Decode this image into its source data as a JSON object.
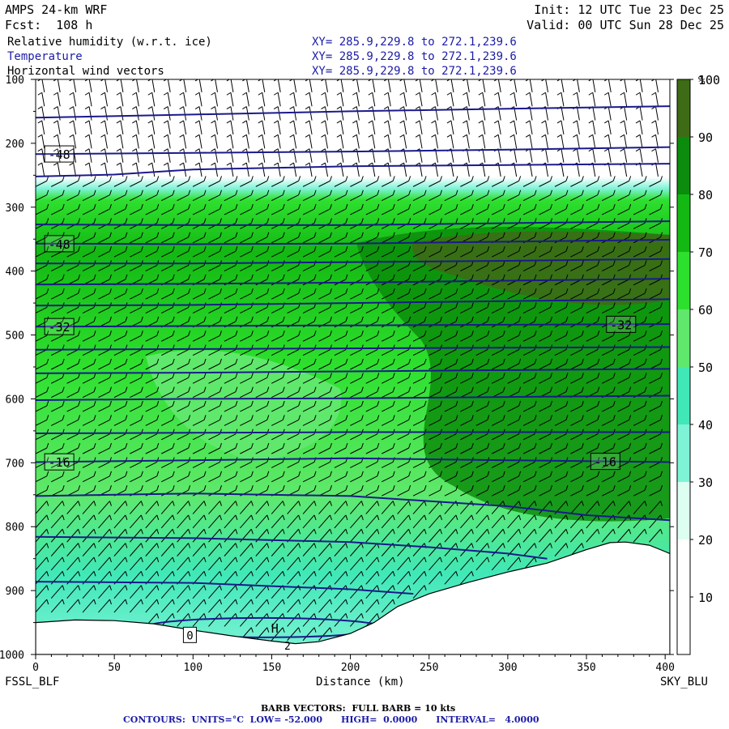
{
  "header": {
    "model": "AMPS 24-km WRF",
    "fcst": "Fcst:  108 h",
    "init": "Init: 12 UTC Tue 23 Dec 25",
    "valid": "Valid: 00 UTC Sun 28 Dec 25",
    "fields": [
      {
        "name": "Relative humidity (w.r.t. ice)",
        "xy": "XY= 285.9,229.8 to 272.1,239.6",
        "color": "#000000"
      },
      {
        "name": "Temperature",
        "xy": "XY= 285.9,229.8 to 272.1,239.6",
        "color": "#1c1ca8"
      },
      {
        "name": "Horizontal wind vectors",
        "xy": "XY= 285.9,229.8 to 272.1,239.6",
        "color": "#000000"
      }
    ]
  },
  "endpoints": {
    "left": "FSSL_BLF",
    "right": "SKY_BLU"
  },
  "footer": {
    "barb": "BARB VECTORS:  FULL BARB = 10 kts",
    "contours": "CONTOURS:  UNITS=°C  LOW= -52.000      HIGH=  0.0000      INTERVAL=   4.0000"
  },
  "chart_data": {
    "type": "heatmap",
    "title": "Relative humidity (w.r.t. ice)",
    "xlabel": "Distance (km)",
    "ylabel": "",
    "xlim": [
      0,
      400
    ],
    "ylim": [
      1000,
      100
    ],
    "x_ticks": [
      "0",
      "50",
      "100",
      "150",
      "200",
      "250",
      "300",
      "350",
      "400"
    ],
    "y_ticks": [
      "100",
      "200",
      "300",
      "400",
      "500",
      "600",
      "700",
      "800",
      "900",
      "1000"
    ],
    "colorbar": {
      "unit": "%",
      "ticks": [
        "10",
        "20",
        "30",
        "40",
        "50",
        "60",
        "70",
        "80",
        "90",
        "100"
      ],
      "colors": [
        "#ffffff",
        "#ffffff",
        "#dcfff2",
        "#7ef3d6",
        "#40e8b8",
        "#5fe86b",
        "#2ee02e",
        "#13b813",
        "#0c8c0c",
        "#3d6b16"
      ]
    },
    "terrain": [
      [
        0,
        950
      ],
      [
        25,
        946
      ],
      [
        50,
        947
      ],
      [
        75,
        952
      ],
      [
        100,
        962
      ],
      [
        125,
        971
      ],
      [
        150,
        979
      ],
      [
        165,
        983
      ],
      [
        180,
        980
      ],
      [
        200,
        967
      ],
      [
        215,
        950
      ],
      [
        230,
        925
      ],
      [
        250,
        905
      ],
      [
        275,
        887
      ],
      [
        300,
        871
      ],
      [
        325,
        857
      ],
      [
        350,
        836
      ],
      [
        365,
        825
      ],
      [
        375,
        824
      ],
      [
        390,
        829
      ],
      [
        400,
        839
      ],
      [
        403,
        842
      ]
    ],
    "temperature_contours": [
      {
        "label": "",
        "points": [
          [
            0,
            160
          ],
          [
            100,
            155
          ],
          [
            200,
            150
          ],
          [
            300,
            146
          ],
          [
            403,
            142
          ]
        ]
      },
      {
        "label": "-48",
        "points": [
          [
            0,
            217
          ],
          [
            100,
            215
          ],
          [
            200,
            213
          ],
          [
            300,
            210
          ],
          [
            403,
            206
          ]
        ]
      },
      {
        "label": "",
        "points": [
          [
            0,
            252
          ],
          [
            50,
            249
          ],
          [
            100,
            241
          ],
          [
            200,
            236
          ],
          [
            300,
            234
          ],
          [
            403,
            232
          ]
        ]
      },
      {
        "label": "",
        "points": [
          [
            0,
            327
          ],
          [
            100,
            328
          ],
          [
            200,
            328
          ],
          [
            300,
            325
          ],
          [
            403,
            322
          ]
        ]
      },
      {
        "label": "-48",
        "points": [
          [
            0,
            357
          ],
          [
            100,
            358
          ],
          [
            200,
            357
          ],
          [
            300,
            354
          ],
          [
            403,
            351
          ]
        ]
      },
      {
        "label": "",
        "points": [
          [
            0,
            388
          ],
          [
            100,
            388
          ],
          [
            200,
            386
          ],
          [
            300,
            384
          ],
          [
            403,
            381
          ]
        ]
      },
      {
        "label": "",
        "points": [
          [
            0,
            421
          ],
          [
            100,
            420
          ],
          [
            200,
            418
          ],
          [
            300,
            415
          ],
          [
            403,
            412
          ]
        ]
      },
      {
        "label": "",
        "points": [
          [
            0,
            454
          ],
          [
            100,
            453
          ],
          [
            200,
            450
          ],
          [
            300,
            447
          ],
          [
            403,
            444
          ]
        ]
      },
      {
        "label": "-32",
        "points": [
          [
            0,
            487
          ],
          [
            100,
            486
          ],
          [
            200,
            485
          ],
          [
            300,
            484
          ],
          [
            403,
            483
          ]
        ]
      },
      {
        "label": "",
        "points": [
          [
            0,
            523
          ],
          [
            100,
            522
          ],
          [
            200,
            521
          ],
          [
            300,
            520
          ],
          [
            403,
            519
          ]
        ]
      },
      {
        "label": "",
        "points": [
          [
            0,
            560
          ],
          [
            100,
            559
          ],
          [
            200,
            557
          ],
          [
            300,
            555
          ],
          [
            403,
            553
          ]
        ]
      },
      {
        "label": "",
        "points": [
          [
            0,
            602
          ],
          [
            100,
            600
          ],
          [
            200,
            599
          ],
          [
            300,
            597
          ],
          [
            403,
            595
          ]
        ]
      },
      {
        "label": "",
        "points": [
          [
            0,
            654
          ],
          [
            100,
            653
          ],
          [
            200,
            652
          ],
          [
            300,
            652
          ],
          [
            403,
            652
          ]
        ]
      },
      {
        "label": "-16",
        "points": [
          [
            0,
            699
          ],
          [
            100,
            696
          ],
          [
            200,
            693
          ],
          [
            300,
            696
          ],
          [
            403,
            699
          ]
        ]
      },
      {
        "label": "",
        "points": [
          [
            0,
            752
          ],
          [
            100,
            748
          ],
          [
            200,
            752
          ],
          [
            300,
            768
          ],
          [
            350,
            782
          ],
          [
            403,
            790
          ]
        ]
      },
      {
        "label": "",
        "points": [
          [
            0,
            816
          ],
          [
            100,
            818
          ],
          [
            200,
            824
          ],
          [
            250,
            832
          ],
          [
            300,
            842
          ],
          [
            325,
            850
          ]
        ]
      },
      {
        "label": "",
        "points": [
          [
            0,
            886
          ],
          [
            100,
            888
          ],
          [
            150,
            893
          ],
          [
            200,
            898
          ],
          [
            240,
            905
          ]
        ]
      }
    ],
    "annotations": [
      "0",
      "H",
      "2"
    ]
  }
}
